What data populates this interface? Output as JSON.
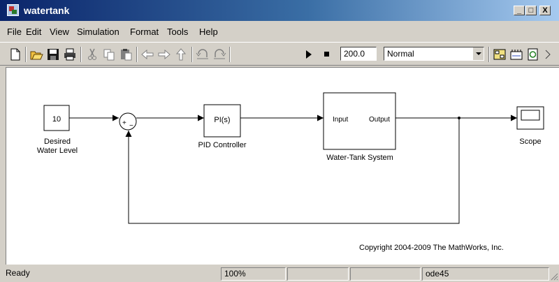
{
  "window": {
    "title": "watertank"
  },
  "caption_buttons": {
    "minimize": "_",
    "maximize": "□",
    "close": "X"
  },
  "menu": [
    "File",
    "Edit",
    "View",
    "Simulation",
    "Format",
    "Tools",
    "Help"
  ],
  "toolbar": {
    "icons": [
      "new-icon",
      "open-icon",
      "save-icon",
      "print-icon",
      "cut-icon",
      "copy-icon",
      "paste-icon",
      "back-icon",
      "forward-icon",
      "up-icon",
      "undo-icon",
      "redo-icon",
      "start-icon",
      "stop-icon",
      "library-browser-icon",
      "model-explorer-icon",
      "refresh-icon"
    ],
    "stop_time": "200.0",
    "sim_mode": "Normal"
  },
  "model": {
    "constant": {
      "value": "10",
      "label_line1": "Desired",
      "label_line2": "Water Level"
    },
    "sum": {
      "sign": "+",
      "sign2": "−"
    },
    "pid": {
      "text": "PI(s)",
      "label": "PID Controller"
    },
    "plant": {
      "in_port": "Input",
      "out_port": "Output",
      "label": "Water-Tank System"
    },
    "scope": {
      "label": "Scope"
    },
    "copyright": "Copyright 2004-2009 The MathWorks, Inc."
  },
  "statusbar": {
    "status": "Ready",
    "zoom": "100%",
    "cell3": "",
    "cell4": "",
    "solver": "ode45"
  }
}
